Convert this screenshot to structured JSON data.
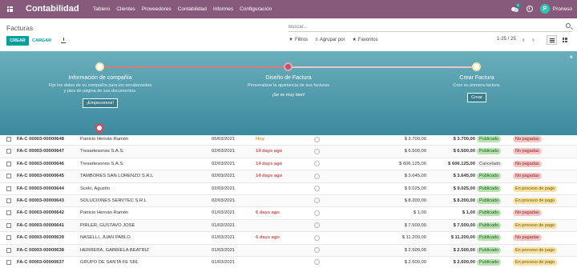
{
  "topbar": {
    "app_title": "Contabilidad",
    "menu": [
      "Tablero",
      "Clientes",
      "Proveedores",
      "Contabilidad",
      "Informes",
      "Configuración"
    ],
    "chat_badge": "5",
    "user_initial": "P",
    "user_name": "Proneso",
    "color": "#875a7b"
  },
  "control_panel": {
    "breadcrumb": "Facturas",
    "search_placeholder": "Buscar...",
    "create_label": "CREAR",
    "load_label": "CARGAR",
    "filters_label": "Filtros",
    "group_by_label": "Agrupar por",
    "favorites_label": "Favoritos",
    "pager": "1-25 / 25",
    "accent": "#00a09d"
  },
  "onboarding": {
    "steps": [
      {
        "title": "Información de compañía",
        "text": "Fije los datos de su compañía para los encabezados y pies de página de sus documentos.",
        "action": "¡Empecemos!"
      },
      {
        "title": "Diseño de Factura",
        "text": "Personalizar la apariencia de sus facturas",
        "action": "¡Se ve muy bien!"
      },
      {
        "title": "Crear Factura",
        "text": "Cree su primera factura.",
        "action": "Crear"
      }
    ]
  },
  "invoices": [
    {
      "number": "FA-C 00003-00000648",
      "partner": "Patricio Hernán Ramón",
      "date": "05/03/2021",
      "due": "Hoy",
      "tax": "$ 3.700,00",
      "total": "$ 3.700,00",
      "state": "Publicado",
      "payment": "No pagadas"
    },
    {
      "number": "FA-C 00003-00000647",
      "partner": "Tresartesonos S.A.S.",
      "date": "02/03/2021",
      "due": "14 days ago",
      "tax": "$ 6.500,00",
      "total": "$ 6.500,00",
      "state": "Publicado",
      "payment": "No pagadas"
    },
    {
      "number": "FA-C 00003-00000646",
      "partner": "Tresartesonos S.A.S.",
      "date": "02/03/2021",
      "due": "14 days ago",
      "tax": "$ 606.125,00",
      "total": "$ 606.125,00",
      "state": "Cancelado",
      "payment": "No pagadas"
    },
    {
      "number": "FA-C 00003-00000645",
      "partner": "TAMBORES SAN LORENZO S.R.L",
      "date": "02/03/2021",
      "due": "14 days ago",
      "tax": "$ 3.645,00",
      "total": "$ 3.645,00",
      "state": "Publicado",
      "payment": "No pagadas"
    },
    {
      "number": "FA-C 00003-00000644",
      "partner": "Scelo, Agustín",
      "date": "02/03/2021",
      "due": "",
      "tax": "$ 9.025,00",
      "total": "$ 9.025,00",
      "state": "Publicado",
      "payment": "En proceso de pago"
    },
    {
      "number": "FA-C 00003-00000643",
      "partner": "SOLUCIONES SERVTEC S.R.L",
      "date": "02/03/2021",
      "due": "",
      "tax": "$ 8.200,00",
      "total": "$ 8.200,00",
      "state": "Publicado",
      "payment": "En proceso de pago"
    },
    {
      "number": "FA-C 00003-00000642",
      "partner": "Patricio Hernán Ramón",
      "date": "01/03/2021",
      "due": "6 days ago",
      "tax": "$ 1,00",
      "total": "$ 1,00",
      "state": "Publicado",
      "payment": "No pagadas"
    },
    {
      "number": "FA-C 00003-00000641",
      "partner": "PIRLER, GUSTAVO JOSE",
      "date": "01/03/2021",
      "due": "",
      "tax": "$ 7.500,00",
      "total": "$ 7.500,00",
      "state": "Publicado",
      "payment": "En proceso de pago"
    },
    {
      "number": "FA-C 00003-00000639",
      "partner": "NASELLI, JUAN PABLO",
      "date": "01/03/2021",
      "due": "6 days ago",
      "tax": "$ 11.200,00",
      "total": "$ 11.200,00",
      "state": "Publicado",
      "payment": "No pagadas"
    },
    {
      "number": "FA-C 00003-00000638",
      "partner": "HERRERA, GABRIELA BEATRIZ",
      "date": "01/03/2021",
      "due": "",
      "tax": "$ 2.500,00",
      "total": "$ 2.500,00",
      "state": "Publicado",
      "payment": "En proceso de pago"
    },
    {
      "number": "FA-C 00003-00000637",
      "partner": "GRUPO DE SANTA FE SRL",
      "date": "01/03/2021",
      "due": "",
      "tax": "$ 2.600,00",
      "total": "$ 2.600,00",
      "state": "Publicado",
      "payment": "En proceso de pago"
    }
  ]
}
